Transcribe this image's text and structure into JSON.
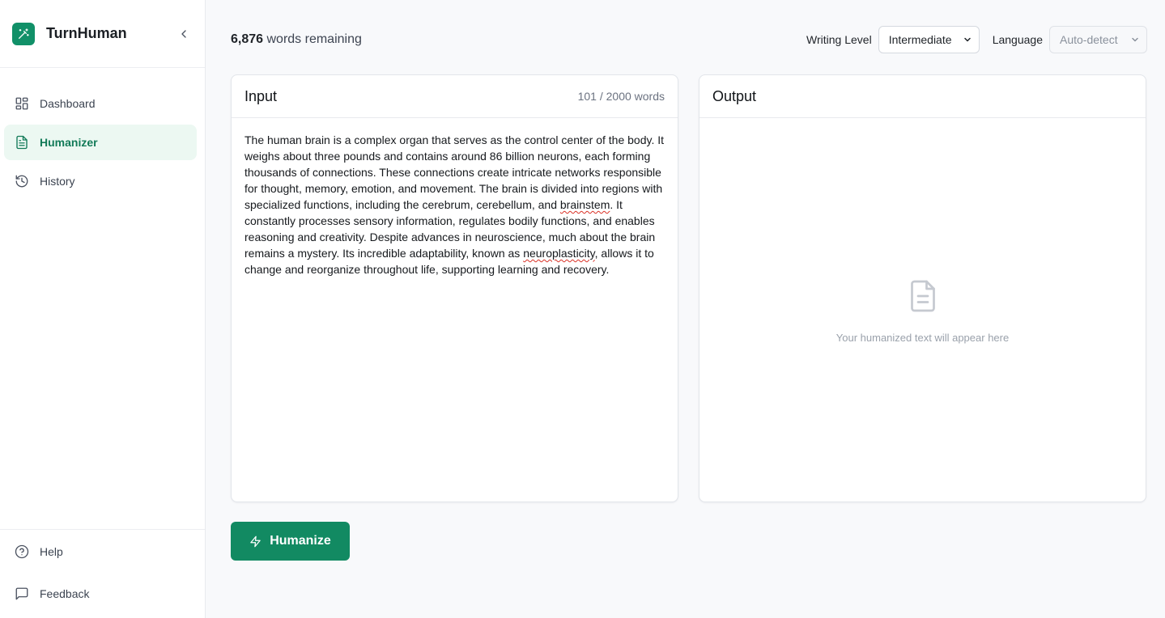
{
  "app": {
    "name": "TurnHuman",
    "brand_color": "#119068",
    "accent_color": "#128a62"
  },
  "sidebar": {
    "items": [
      {
        "label": "Dashboard",
        "icon": "grid-icon",
        "active": false
      },
      {
        "label": "Humanizer",
        "icon": "document-icon",
        "active": true
      },
      {
        "label": "History",
        "icon": "history-icon",
        "active": false
      }
    ],
    "bottom": [
      {
        "label": "Help",
        "icon": "help-circle-icon"
      },
      {
        "label": "Feedback",
        "icon": "message-square-icon"
      }
    ]
  },
  "topbar": {
    "words_remaining_count": "6,876",
    "words_remaining_text": "words remaining",
    "writing_level_label": "Writing Level",
    "writing_level_value": "Intermediate",
    "language_label": "Language",
    "language_value": "Auto-detect"
  },
  "input_panel": {
    "title": "Input",
    "word_count": "101 / 2000 words",
    "text_parts": [
      "The human brain is a complex organ that serves as the control center of the body. It weighs about three pounds and contains around 86 billion neurons, each forming thousands of connections. These connections create intricate networks responsible for thought, memory, emotion, and movement. The brain is divided into regions with specialized functions, including the cerebrum, cerebellum, and ",
      "brainstem",
      ". It constantly processes sensory information, regulates bodily functions, and enables reasoning and creativity. Despite advances in neuroscience, much about the brain remains a mystery. Its incredible adaptability, known as ",
      "neuroplasticity",
      ", allows it to change and reorganize throughout life, supporting learning and recovery."
    ]
  },
  "output_panel": {
    "title": "Output",
    "placeholder": "Your humanized text will appear here",
    "icon": "file-text-icon"
  },
  "actions": {
    "humanize_label": "Humanize",
    "humanize_icon": "bolt-icon"
  }
}
